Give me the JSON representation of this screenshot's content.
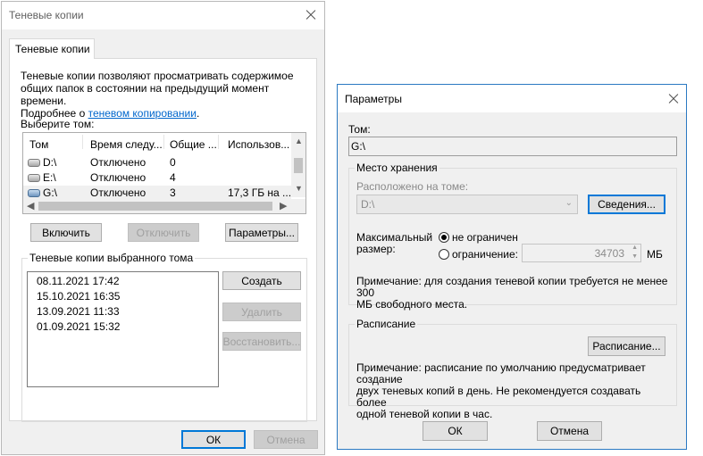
{
  "left_dialog": {
    "title": "Теневые копии",
    "tab_label": "Теневые копии",
    "description": "Теневые копии позволяют просматривать содержимое общих папок в состоянии на предыдущий момент времени.",
    "more_prefix": "Подробнее о ",
    "more_link": "теневом копировании",
    "more_suffix": ".",
    "volume_label": "Выберите том:",
    "columns": [
      "Том",
      "Время следу...",
      "Общие ...",
      "Использов..."
    ],
    "volumes": [
      {
        "name": "D:\\",
        "next_run": "Отключено",
        "shares": "0",
        "used": ""
      },
      {
        "name": "E:\\",
        "next_run": "Отключено",
        "shares": "4",
        "used": ""
      },
      {
        "name": "G:\\",
        "next_run": "Отключено",
        "shares": "3",
        "used": "17,3 ГБ на ..."
      }
    ],
    "enable_button": "Включить",
    "disable_button": "Отключить",
    "settings_button": "Параметры...",
    "snapshots_group": "Теневые копии выбранного тома",
    "snapshots": [
      "08.11.2021 17:42",
      "15.10.2021 16:35",
      "13.09.2021 11:33",
      "01.09.2021 15:32"
    ],
    "create_button": "Создать",
    "delete_button": "Удалить",
    "restore_button": "Восстановить...",
    "ok_button": "ОК",
    "cancel_button": "Отмена"
  },
  "right_dialog": {
    "title": "Параметры",
    "volume_label": "Том:",
    "volume_value": "G:\\",
    "storage_group": "Место хранения",
    "located_label": "Расположено на томе:",
    "located_value": "D:\\",
    "details_button": "Сведения...",
    "max_size_label_1": "Максимальный",
    "max_size_label_2": "размер:",
    "unlimited_option": "не ограничен",
    "limit_option": "ограничение:",
    "limit_value": "34703",
    "unit": "МБ",
    "storage_note_1": "Примечание: для создания теневой копии требуется не менее 300",
    "storage_note_2": "МБ свободного места.",
    "schedule_group": "Расписание",
    "schedule_button": "Расписание...",
    "schedule_note_1": "Примечание: расписание по умолчанию предусматривает создание",
    "schedule_note_2": "двух теневых копий в день. Не рекомендуется создавать более",
    "schedule_note_3": "одной теневой копии в час.",
    "ok_button": "ОК",
    "cancel_button": "Отмена"
  }
}
